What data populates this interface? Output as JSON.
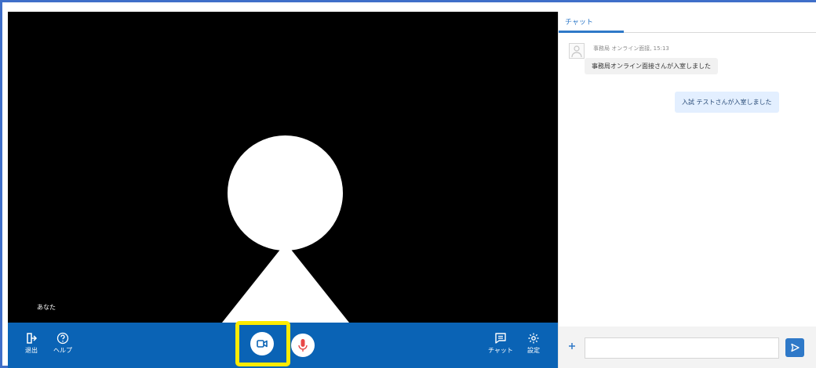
{
  "colors": {
    "frame": "#3f6fc9",
    "toolbar": "#0a63b5",
    "highlight": "#ffeb00",
    "chat_accent": "#2f79c8",
    "camera_icon": "#0a63b5",
    "mic_icon": "#e84848"
  },
  "video": {
    "participant_label": "あなた"
  },
  "toolbar": {
    "leave_label": "退出",
    "leave_icon": "exit-icon",
    "help_label": "ヘルプ",
    "help_icon": "help-circle-icon",
    "camera_icon": "video-camera-icon",
    "mic_icon": "microphone-icon",
    "chat_label": "チャット",
    "chat_icon": "chat-bubble-icon",
    "settings_label": "設定",
    "settings_icon": "gear-icon"
  },
  "chat": {
    "tab_label": "チャット",
    "message_meta": "事務局 オンライン面接, 15:13",
    "incoming_message": "事務局オンライン面接さんが入室しました",
    "outgoing_message": "入試 テストさんが入室しました",
    "input_placeholder": "",
    "attach_icon": "plus-icon",
    "send_icon": "send-icon"
  }
}
